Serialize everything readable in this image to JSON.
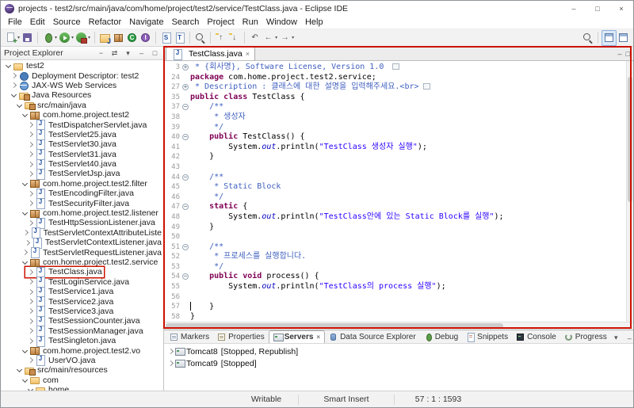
{
  "window": {
    "title": "projects - test2/src/main/java/com/home/project/test2/service/TestClass.java - Eclipse IDE"
  },
  "window_controls": {
    "minimize": "–",
    "maximize": "□",
    "close": "×"
  },
  "menu": [
    "File",
    "Edit",
    "Source",
    "Refactor",
    "Navigate",
    "Search",
    "Project",
    "Run",
    "Window",
    "Help"
  ],
  "toolbar": [
    {
      "name": "new-wizard-button",
      "icon": "new",
      "arrow": true
    },
    {
      "name": "save-button",
      "icon": "save"
    },
    {
      "sep": true
    },
    {
      "name": "debug-button",
      "icon": "debug",
      "arrow": true
    },
    {
      "name": "run-button",
      "icon": "run",
      "arrow": true
    },
    {
      "name": "external-tools-button",
      "icon": "ext",
      "arrow": true
    },
    {
      "sep": true
    },
    {
      "name": "new-java-project-button",
      "icon": "jproj"
    },
    {
      "name": "new-package-button",
      "icon": "pkg"
    },
    {
      "name": "new-class-button",
      "icon": "class"
    },
    {
      "name": "new-interface-button",
      "icon": "iface"
    },
    {
      "sep": true
    },
    {
      "name": "new-servlet-button",
      "icon": "servlet"
    },
    {
      "name": "open-type-button",
      "icon": "type"
    },
    {
      "sep": true
    },
    {
      "name": "search-button",
      "icon": "mag"
    },
    {
      "sep": true
    },
    {
      "name": "previous-annotation-button",
      "icon": "prev"
    },
    {
      "name": "next-annotation-button",
      "icon": "next"
    },
    {
      "sep": true
    },
    {
      "name": "last-edit-location-button",
      "icon": "lastedit"
    },
    {
      "name": "back-button",
      "icon": "back",
      "arrow": true
    },
    {
      "name": "forward-button",
      "icon": "fwd",
      "arrow": true
    }
  ],
  "toolbar_right": [
    {
      "name": "quick-search-button",
      "icon": "mag"
    },
    {
      "sep": true
    },
    {
      "name": "javaee-perspective-button",
      "icon": "persp",
      "active": true
    },
    {
      "name": "java-perspective-button",
      "icon": "persp"
    }
  ],
  "project_explorer": {
    "title": "Project Explorer",
    "view_toolbar": [
      {
        "name": "collapse-all-button",
        "glyph": "−"
      },
      {
        "name": "link-with-editor-button",
        "glyph": "⇄"
      },
      {
        "name": "view-menu-button",
        "glyph": "▾"
      },
      {
        "name": "minimize-view-button",
        "glyph": "–"
      },
      {
        "name": "maximize-view-button",
        "glyph": "□"
      }
    ],
    "tree": [
      {
        "label": "test2",
        "level": 0,
        "expander": "open",
        "icon": "project"
      },
      {
        "label": "Deployment Descriptor: test2",
        "level": 1,
        "expander": "closed",
        "icon": "descriptor"
      },
      {
        "label": "JAX-WS Web Services",
        "level": 1,
        "expander": "closed",
        "icon": "jaxws"
      },
      {
        "label": "Java Resources",
        "level": 1,
        "expander": "open",
        "icon": "jres"
      },
      {
        "label": "src/main/java",
        "level": 2,
        "expander": "open",
        "icon": "srcfolder"
      },
      {
        "label": "com.home.project.test2",
        "level": 3,
        "expander": "open",
        "icon": "package"
      },
      {
        "label": "TestDispatcherServlet.java",
        "level": 4,
        "expander": "closed",
        "icon": "jfile"
      },
      {
        "label": "TestServlet25.java",
        "level": 4,
        "expander": "closed",
        "icon": "jfile"
      },
      {
        "label": "TestServlet30.java",
        "level": 4,
        "expander": "closed",
        "icon": "jfile"
      },
      {
        "label": "TestServlet31.java",
        "level": 4,
        "expander": "closed",
        "icon": "jfile"
      },
      {
        "label": "TestServlet40.java",
        "level": 4,
        "expander": "closed",
        "icon": "jfile"
      },
      {
        "label": "TestServletJsp.java",
        "level": 4,
        "expander": "closed",
        "icon": "jfile"
      },
      {
        "label": "com.home.project.test2.filter",
        "level": 3,
        "expander": "open",
        "icon": "package"
      },
      {
        "label": "TestEncodingFilter.java",
        "level": 4,
        "expander": "closed",
        "icon": "jfile"
      },
      {
        "label": "TestSecurityFilter.java",
        "level": 4,
        "expander": "closed",
        "icon": "jfile"
      },
      {
        "label": "com.home.project.test2.listener",
        "level": 3,
        "expander": "open",
        "icon": "package"
      },
      {
        "label": "TestHttpSessionListener.java",
        "level": 4,
        "expander": "closed",
        "icon": "jfile"
      },
      {
        "label": "TestServletContextAttributeListe",
        "level": 4,
        "expander": "closed",
        "icon": "jfile"
      },
      {
        "label": "TestServletContextListener.java",
        "level": 4,
        "expander": "closed",
        "icon": "jfile"
      },
      {
        "label": "TestServletRequestListener.java",
        "level": 4,
        "expander": "closed",
        "icon": "jfile"
      },
      {
        "label": "com.home.project.test2.service",
        "level": 3,
        "expander": "open",
        "icon": "package"
      },
      {
        "label": "TestClass.java",
        "level": 4,
        "expander": "closed",
        "icon": "jfile",
        "boxed": true
      },
      {
        "label": "TestLoginService.java",
        "level": 4,
        "expander": "closed",
        "icon": "jfile"
      },
      {
        "label": "TestService1.java",
        "level": 4,
        "expander": "closed",
        "icon": "jfile"
      },
      {
        "label": "TestService2.java",
        "level": 4,
        "expander": "closed",
        "icon": "jfile"
      },
      {
        "label": "TestService3.java",
        "level": 4,
        "expander": "closed",
        "icon": "jfile"
      },
      {
        "label": "TestSessionCounter.java",
        "level": 4,
        "expander": "closed",
        "icon": "jfile"
      },
      {
        "label": "TestSessionManager.java",
        "level": 4,
        "expander": "closed",
        "icon": "jfile"
      },
      {
        "label": "TestSingleton.java",
        "level": 4,
        "expander": "closed",
        "icon": "jfile"
      },
      {
        "label": "com.home.project.test2.vo",
        "level": 3,
        "expander": "open",
        "icon": "package"
      },
      {
        "label": "UserVO.java",
        "level": 4,
        "expander": "closed",
        "icon": "jfile"
      },
      {
        "label": "src/main/resources",
        "level": 2,
        "expander": "open",
        "icon": "srcfolder"
      },
      {
        "label": "com",
        "level": 3,
        "expander": "open",
        "icon": "folder"
      },
      {
        "label": "home",
        "level": 4,
        "expander": "open",
        "icon": "folder"
      }
    ]
  },
  "editor": {
    "tab": {
      "label": "TestClass.java",
      "close": "×"
    },
    "lines": [
      {
        "num": "3",
        "fold": "plus",
        "badge": true,
        "segs": [
          [
            " * {회사명}, Software License, Version 1.0 ",
            "j"
          ]
        ]
      },
      {
        "num": "24",
        "segs": [
          [
            "package",
            "k"
          ],
          [
            " com.home.project.test2.service;",
            "p"
          ]
        ]
      },
      {
        "num": "27",
        "fold": "plus",
        "badge": true,
        "segs": [
          [
            " * Description : 클래스에 대한 설명을 입력해주세요.<br>",
            "j"
          ]
        ]
      },
      {
        "num": "35",
        "segs": [
          [
            "public",
            "k"
          ],
          [
            " ",
            "p"
          ],
          [
            "class",
            "k"
          ],
          [
            " TestClass {",
            "p"
          ]
        ]
      },
      {
        "num": "37",
        "fold": "minus",
        "segs": [
          [
            "    /**",
            "j"
          ]
        ]
      },
      {
        "num": "38",
        "segs": [
          [
            "     * 생성자",
            "j"
          ]
        ]
      },
      {
        "num": "39",
        "segs": [
          [
            "     */",
            "j"
          ]
        ]
      },
      {
        "num": "40",
        "fold": "minus",
        "segs": [
          [
            "    ",
            "p"
          ],
          [
            "public",
            "k"
          ],
          [
            " TestClass() {",
            "p"
          ]
        ]
      },
      {
        "num": "41",
        "segs": [
          [
            "        System.",
            "p"
          ],
          [
            "out",
            "f"
          ],
          [
            ".println(",
            "p"
          ],
          [
            "\"TestClass 생성자 실행\"",
            "s"
          ],
          [
            ");",
            "p"
          ]
        ]
      },
      {
        "num": "42",
        "segs": [
          [
            "    }",
            "p"
          ]
        ]
      },
      {
        "num": "43",
        "segs": []
      },
      {
        "num": "44",
        "fold": "minus",
        "segs": [
          [
            "    /**",
            "j"
          ]
        ]
      },
      {
        "num": "45",
        "segs": [
          [
            "     * Static Block",
            "j"
          ]
        ]
      },
      {
        "num": "46",
        "segs": [
          [
            "     */",
            "j"
          ]
        ]
      },
      {
        "num": "47",
        "fold": "minus",
        "segs": [
          [
            "    ",
            "p"
          ],
          [
            "static",
            "k"
          ],
          [
            " {",
            "p"
          ]
        ]
      },
      {
        "num": "48",
        "segs": [
          [
            "        System.",
            "p"
          ],
          [
            "out",
            "f"
          ],
          [
            ".println(",
            "p"
          ],
          [
            "\"TestClass안에 있는 Static Block를 실행\"",
            "s"
          ],
          [
            ");",
            "p"
          ]
        ]
      },
      {
        "num": "49",
        "segs": [
          [
            "    }",
            "p"
          ]
        ]
      },
      {
        "num": "50",
        "segs": []
      },
      {
        "num": "51",
        "fold": "minus",
        "segs": [
          [
            "    /**",
            "j"
          ]
        ]
      },
      {
        "num": "52",
        "segs": [
          [
            "     * 프로세스를 실행합니다.",
            "j"
          ]
        ]
      },
      {
        "num": "53",
        "segs": [
          [
            "     */",
            "j"
          ]
        ]
      },
      {
        "num": "54",
        "fold": "minus",
        "segs": [
          [
            "    ",
            "p"
          ],
          [
            "public",
            "k"
          ],
          [
            " ",
            "p"
          ],
          [
            "void",
            "k"
          ],
          [
            " process() {",
            "p"
          ]
        ]
      },
      {
        "num": "55",
        "segs": [
          [
            "        System.",
            "p"
          ],
          [
            "out",
            "f"
          ],
          [
            ".println(",
            "p"
          ],
          [
            "\"TestClass의 process 실행\"",
            "s"
          ],
          [
            ");",
            "p"
          ]
        ]
      },
      {
        "num": "56",
        "segs": []
      },
      {
        "num": "57",
        "caret": true,
        "segs": [
          [
            "    }",
            "p"
          ]
        ]
      },
      {
        "num": "58",
        "segs": [
          [
            "}",
            "p"
          ]
        ]
      }
    ]
  },
  "bottom_panel": {
    "tabs": [
      {
        "label": "Markers",
        "icon": "markers"
      },
      {
        "label": "Properties",
        "icon": "properties"
      },
      {
        "label": "Servers",
        "icon": "servers",
        "active": true,
        "close": "×"
      },
      {
        "label": "Data Source Explorer",
        "icon": "datasource"
      },
      {
        "label": "Debug",
        "icon": "debugview"
      },
      {
        "label": "Snippets",
        "icon": "snippets"
      },
      {
        "label": "Console",
        "icon": "console"
      },
      {
        "label": "Progress",
        "icon": "progress"
      }
    ],
    "view_toolbar": [
      {
        "name": "view-menu-button",
        "glyph": "▾"
      },
      {
        "name": "minimize-view-button",
        "glyph": "–"
      },
      {
        "name": "maximize-view-button",
        "glyph": "□"
      }
    ],
    "servers": [
      {
        "name": "Tomcat8",
        "status": "[Stopped, Republish]"
      },
      {
        "name": "Tomcat9",
        "status": "[Stopped]"
      }
    ]
  },
  "status_bar": {
    "writable": "Writable",
    "insert_mode": "Smart Insert",
    "caret_position": "57 : 1 : 1593"
  },
  "colors": {
    "keyword": "#7f0055",
    "string": "#2a00ff",
    "javadoc": "#3f5fbf",
    "static_field": "#0000c0",
    "annotation_red": "#cc1100"
  }
}
